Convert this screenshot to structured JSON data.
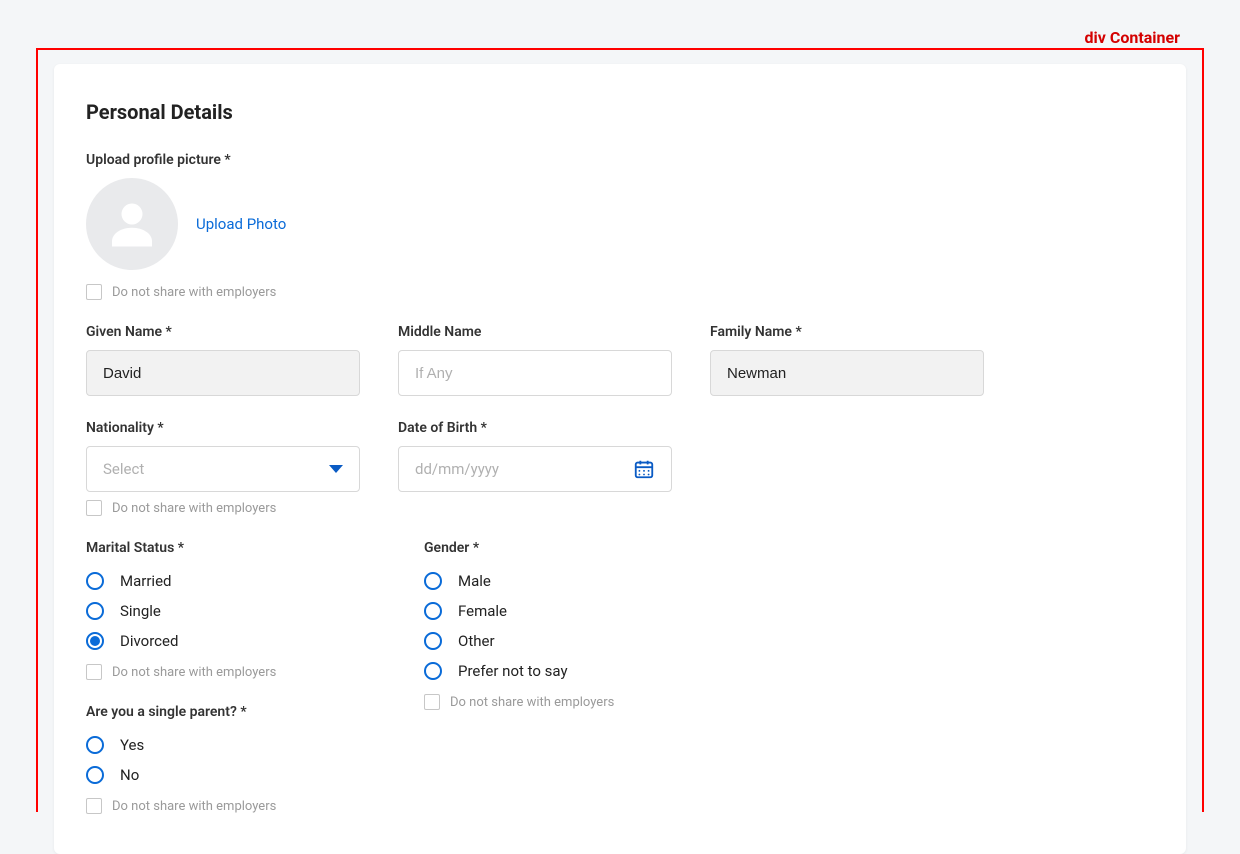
{
  "debugLabel": "div Container",
  "section": {
    "title": "Personal Details",
    "uploadLabel": "Upload profile picture *",
    "uploadLinkText": "Upload Photo",
    "doNotShareText": "Do not share with employers"
  },
  "fields": {
    "givenName": {
      "label": "Given Name *",
      "value": "David"
    },
    "middleName": {
      "label": "Middle Name",
      "placeholder": "If Any",
      "value": ""
    },
    "familyName": {
      "label": "Family Name *",
      "value": "Newman"
    },
    "nationality": {
      "label": "Nationality *",
      "placeholder": "Select",
      "value": ""
    },
    "dob": {
      "label": "Date of Birth *",
      "placeholder": "dd/mm/yyyy",
      "value": ""
    }
  },
  "maritalStatus": {
    "label": "Marital Status *",
    "options": [
      "Married",
      "Single",
      "Divorced"
    ],
    "selected": "Divorced"
  },
  "gender": {
    "label": "Gender *",
    "options": [
      "Male",
      "Female",
      "Other",
      "Prefer not to say"
    ],
    "selected": ""
  },
  "singleParent": {
    "label": "Are you a single parent? *",
    "options": [
      "Yes",
      "No"
    ],
    "selected": ""
  }
}
